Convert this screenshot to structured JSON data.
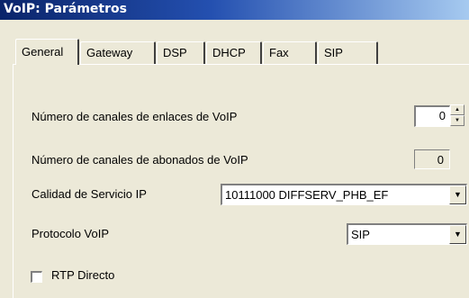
{
  "window": {
    "title": "VoIP: Parámetros"
  },
  "tabs": [
    {
      "label": "General"
    },
    {
      "label": "Gateway"
    },
    {
      "label": "DSP"
    },
    {
      "label": "DHCP"
    },
    {
      "label": "Fax"
    },
    {
      "label": "SIP"
    }
  ],
  "form": {
    "trunk_channels_label": "Número de canales de enlaces de VoIP",
    "trunk_channels_value": "0",
    "subscriber_channels_label": "Número de canales de abonados de VoIP",
    "subscriber_channels_value": "0",
    "qos_label": "Calidad de Servicio IP",
    "qos_value": "10111000  DIFFSERV_PHB_EF",
    "protocol_label": "Protocolo VoIP",
    "protocol_value": "SIP",
    "rtp_direct_label": "RTP Directo"
  },
  "icons": {
    "spin_up": "up-arrow-icon",
    "spin_down": "down-arrow-icon",
    "dropdown": "chevron-down-icon"
  }
}
